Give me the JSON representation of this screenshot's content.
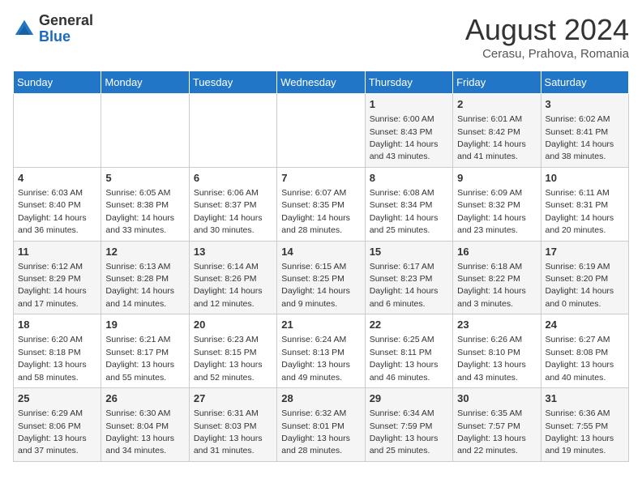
{
  "header": {
    "logo_line1": "General",
    "logo_line2": "Blue",
    "month": "August 2024",
    "location": "Cerasu, Prahova, Romania"
  },
  "days_of_week": [
    "Sunday",
    "Monday",
    "Tuesday",
    "Wednesday",
    "Thursday",
    "Friday",
    "Saturday"
  ],
  "weeks": [
    [
      {
        "day": "",
        "info": ""
      },
      {
        "day": "",
        "info": ""
      },
      {
        "day": "",
        "info": ""
      },
      {
        "day": "",
        "info": ""
      },
      {
        "day": "1",
        "info": "Sunrise: 6:00 AM\nSunset: 8:43 PM\nDaylight: 14 hours and 43 minutes."
      },
      {
        "day": "2",
        "info": "Sunrise: 6:01 AM\nSunset: 8:42 PM\nDaylight: 14 hours and 41 minutes."
      },
      {
        "day": "3",
        "info": "Sunrise: 6:02 AM\nSunset: 8:41 PM\nDaylight: 14 hours and 38 minutes."
      }
    ],
    [
      {
        "day": "4",
        "info": "Sunrise: 6:03 AM\nSunset: 8:40 PM\nDaylight: 14 hours and 36 minutes."
      },
      {
        "day": "5",
        "info": "Sunrise: 6:05 AM\nSunset: 8:38 PM\nDaylight: 14 hours and 33 minutes."
      },
      {
        "day": "6",
        "info": "Sunrise: 6:06 AM\nSunset: 8:37 PM\nDaylight: 14 hours and 30 minutes."
      },
      {
        "day": "7",
        "info": "Sunrise: 6:07 AM\nSunset: 8:35 PM\nDaylight: 14 hours and 28 minutes."
      },
      {
        "day": "8",
        "info": "Sunrise: 6:08 AM\nSunset: 8:34 PM\nDaylight: 14 hours and 25 minutes."
      },
      {
        "day": "9",
        "info": "Sunrise: 6:09 AM\nSunset: 8:32 PM\nDaylight: 14 hours and 23 minutes."
      },
      {
        "day": "10",
        "info": "Sunrise: 6:11 AM\nSunset: 8:31 PM\nDaylight: 14 hours and 20 minutes."
      }
    ],
    [
      {
        "day": "11",
        "info": "Sunrise: 6:12 AM\nSunset: 8:29 PM\nDaylight: 14 hours and 17 minutes."
      },
      {
        "day": "12",
        "info": "Sunrise: 6:13 AM\nSunset: 8:28 PM\nDaylight: 14 hours and 14 minutes."
      },
      {
        "day": "13",
        "info": "Sunrise: 6:14 AM\nSunset: 8:26 PM\nDaylight: 14 hours and 12 minutes."
      },
      {
        "day": "14",
        "info": "Sunrise: 6:15 AM\nSunset: 8:25 PM\nDaylight: 14 hours and 9 minutes."
      },
      {
        "day": "15",
        "info": "Sunrise: 6:17 AM\nSunset: 8:23 PM\nDaylight: 14 hours and 6 minutes."
      },
      {
        "day": "16",
        "info": "Sunrise: 6:18 AM\nSunset: 8:22 PM\nDaylight: 14 hours and 3 minutes."
      },
      {
        "day": "17",
        "info": "Sunrise: 6:19 AM\nSunset: 8:20 PM\nDaylight: 14 hours and 0 minutes."
      }
    ],
    [
      {
        "day": "18",
        "info": "Sunrise: 6:20 AM\nSunset: 8:18 PM\nDaylight: 13 hours and 58 minutes."
      },
      {
        "day": "19",
        "info": "Sunrise: 6:21 AM\nSunset: 8:17 PM\nDaylight: 13 hours and 55 minutes."
      },
      {
        "day": "20",
        "info": "Sunrise: 6:23 AM\nSunset: 8:15 PM\nDaylight: 13 hours and 52 minutes."
      },
      {
        "day": "21",
        "info": "Sunrise: 6:24 AM\nSunset: 8:13 PM\nDaylight: 13 hours and 49 minutes."
      },
      {
        "day": "22",
        "info": "Sunrise: 6:25 AM\nSunset: 8:11 PM\nDaylight: 13 hours and 46 minutes."
      },
      {
        "day": "23",
        "info": "Sunrise: 6:26 AM\nSunset: 8:10 PM\nDaylight: 13 hours and 43 minutes."
      },
      {
        "day": "24",
        "info": "Sunrise: 6:27 AM\nSunset: 8:08 PM\nDaylight: 13 hours and 40 minutes."
      }
    ],
    [
      {
        "day": "25",
        "info": "Sunrise: 6:29 AM\nSunset: 8:06 PM\nDaylight: 13 hours and 37 minutes."
      },
      {
        "day": "26",
        "info": "Sunrise: 6:30 AM\nSunset: 8:04 PM\nDaylight: 13 hours and 34 minutes."
      },
      {
        "day": "27",
        "info": "Sunrise: 6:31 AM\nSunset: 8:03 PM\nDaylight: 13 hours and 31 minutes."
      },
      {
        "day": "28",
        "info": "Sunrise: 6:32 AM\nSunset: 8:01 PM\nDaylight: 13 hours and 28 minutes."
      },
      {
        "day": "29",
        "info": "Sunrise: 6:34 AM\nSunset: 7:59 PM\nDaylight: 13 hours and 25 minutes."
      },
      {
        "day": "30",
        "info": "Sunrise: 6:35 AM\nSunset: 7:57 PM\nDaylight: 13 hours and 22 minutes."
      },
      {
        "day": "31",
        "info": "Sunrise: 6:36 AM\nSunset: 7:55 PM\nDaylight: 13 hours and 19 minutes."
      }
    ]
  ]
}
